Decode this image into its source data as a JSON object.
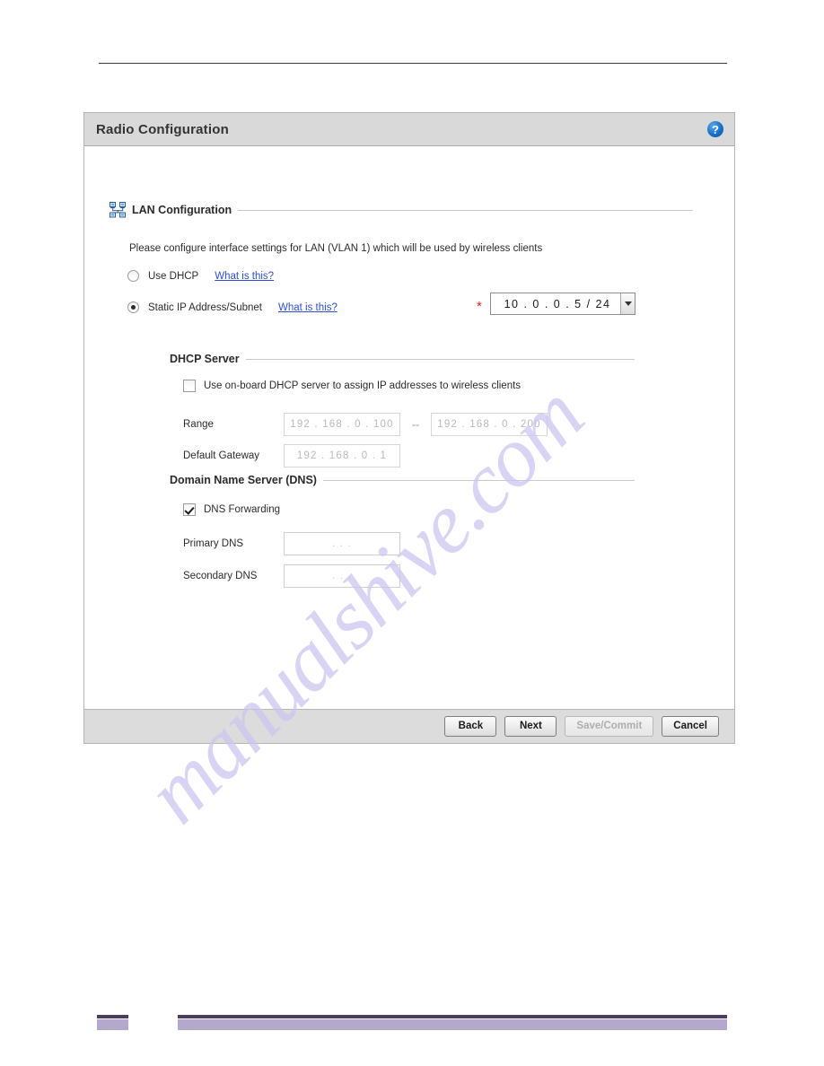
{
  "dialog": {
    "title": "Radio Configuration",
    "help_icon": "help-circle-icon",
    "help_glyph": "?"
  },
  "lan_section": {
    "icon": "lan-network-icon",
    "title": "LAN Configuration",
    "intro": "Please configure interface settings for LAN (VLAN 1) which will be used by wireless clients",
    "options": [
      {
        "label": "Use DHCP",
        "link": "What is this?",
        "selected": false
      },
      {
        "label": "Static IP Address/Subnet",
        "link": "What is this?",
        "selected": true
      }
    ],
    "required_marker": "*",
    "static_ip_value": "10 . 0 . 0 . 5 / 24"
  },
  "dhcp_section": {
    "title": "DHCP Server",
    "enable_checkbox": {
      "label": "Use on-board DHCP server to assign IP addresses to wireless clients",
      "checked": false
    },
    "range_label": "Range",
    "range_start": "192 . 168 .  0  . 100",
    "range_separator": "--",
    "range_end": "192 . 168 .  0  . 200",
    "gateway_label": "Default Gateway",
    "gateway_value": "192 . 168 .  0  .  1"
  },
  "dns_section": {
    "title": "Domain Name Server (DNS)",
    "forwarding_checkbox": {
      "label": "DNS Forwarding",
      "checked": true
    },
    "primary_label": "Primary DNS",
    "primary_value": ".     .     .",
    "secondary_label": "Secondary DNS",
    "secondary_value": ".     .     ."
  },
  "footer_buttons": [
    {
      "label": "Back",
      "disabled": false
    },
    {
      "label": "Next",
      "disabled": false
    },
    {
      "label": "Save/Commit",
      "disabled": true
    },
    {
      "label": "Cancel",
      "disabled": false
    }
  ],
  "watermark": {
    "text": "manualshive.com"
  }
}
